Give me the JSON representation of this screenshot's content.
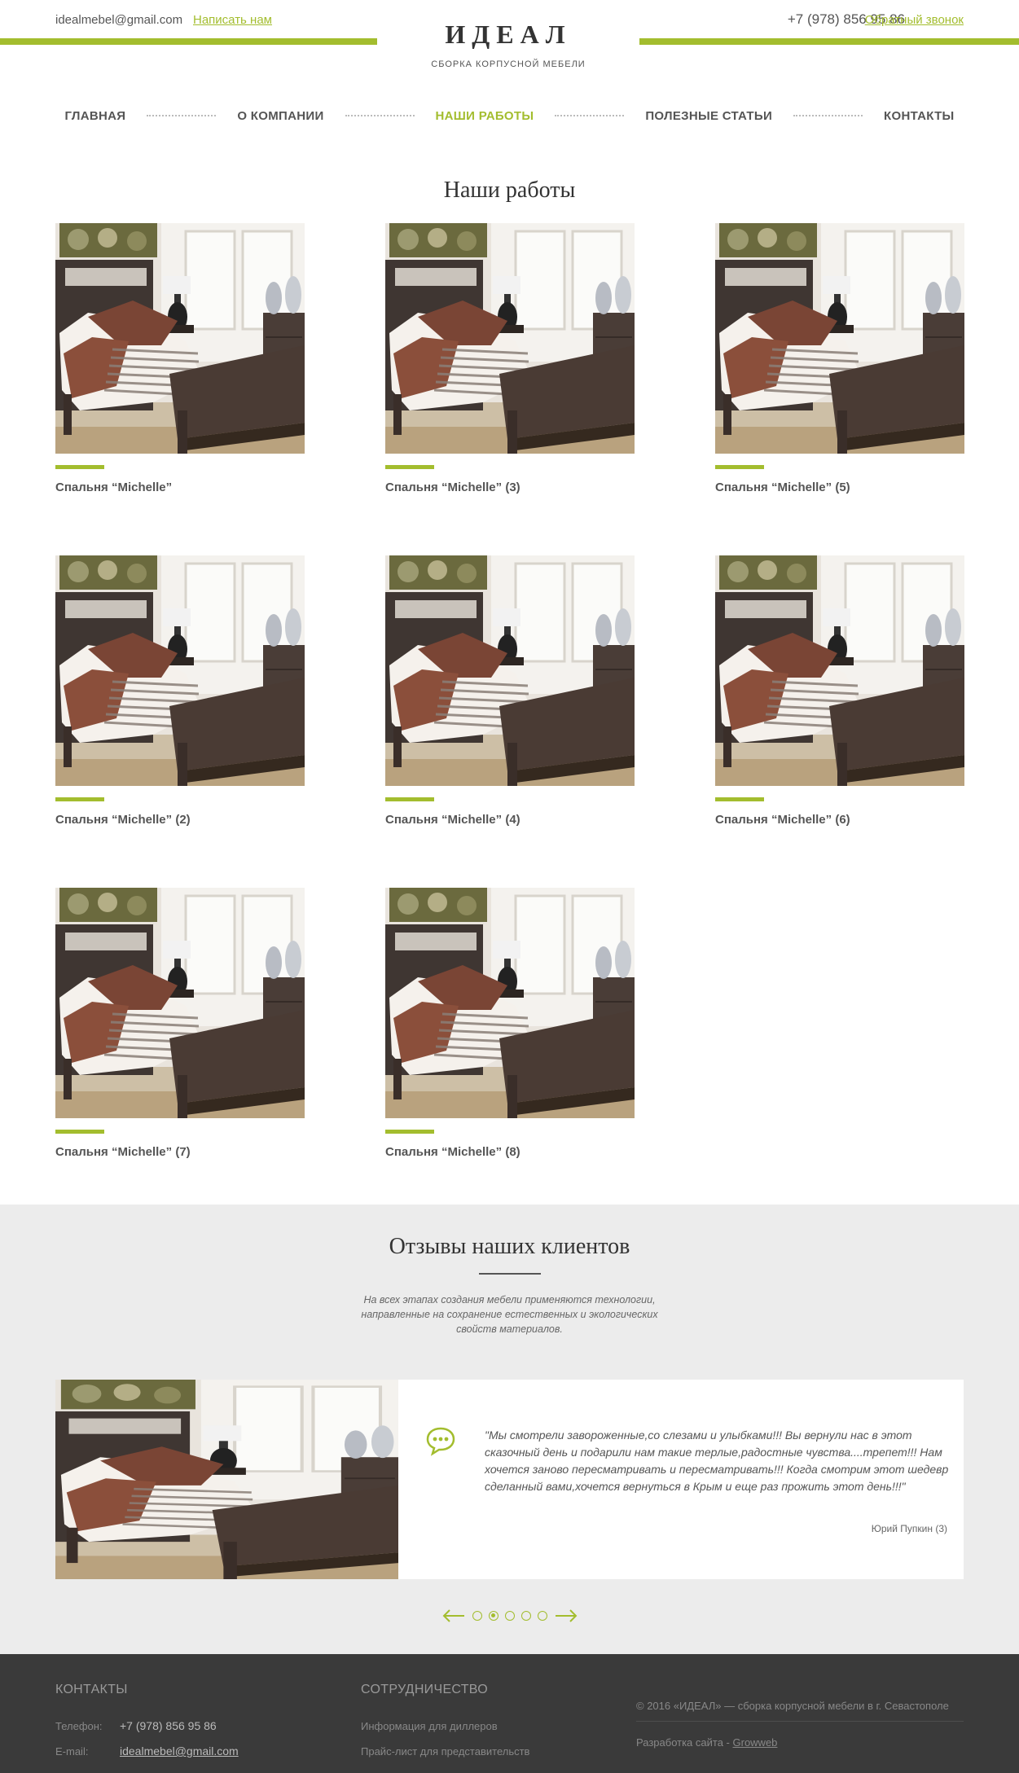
{
  "header": {
    "email": "idealmebel@gmail.com",
    "write_link": "Написать нам",
    "phone": "+7 (978) 856 95 86",
    "callback_link": "Обратный звонок",
    "logo_title": "ИДЕАЛ",
    "logo_subtitle": "СБОРКА КОРПУСНОЙ МЕБЕЛИ"
  },
  "nav": {
    "items": [
      {
        "label": "ГЛАВНАЯ"
      },
      {
        "label": "О КОМПАНИИ"
      },
      {
        "label": "НАШИ РАБОТЫ"
      },
      {
        "label": "ПОЛЕЗНЫЕ СТАТЬИ"
      },
      {
        "label": "КОНТАКТЫ"
      }
    ],
    "active_index": 2
  },
  "works": {
    "title": "Наши работы",
    "items": [
      {
        "label": "Спальня “Michelle”"
      },
      {
        "label": "Спальня “Michelle” (3)"
      },
      {
        "label": "Спальня “Michelle” (5)"
      },
      {
        "label": "Спальня “Michelle” (2)"
      },
      {
        "label": "Спальня “Michelle” (4)"
      },
      {
        "label": "Спальня “Michelle” (6)"
      },
      {
        "label": "Спальня “Michelle” (7)"
      },
      {
        "label": "Спальня “Michelle” (8)"
      }
    ]
  },
  "reviews": {
    "title": "Отзывы наших клиентов",
    "description": "На всех этапах создания мебели применяются технологии, направленные на сохранение естественных и экологических свойств материалов.",
    "review_text": "\"Мы смотрели завороженные,со слезами и улыбками!!! Вы вернули нас в этот сказочный день и подарили нам такие терлые,радостные чувства....трепет!!! Нам хочется заново пересматривать и пересматривать!!! Когда смотрим этот шедевр сделанный вами,хочется вернуться в Крым и еще раз прожить этот день!!!\"",
    "review_author": "Юрий Пупкин (3)",
    "dots_count": 5,
    "active_dot": 1
  },
  "footer": {
    "contacts_title": "КОНТАКТЫ",
    "phone_label": "Телефон:",
    "phone_value": "+7 (978) 856 95 86",
    "email_label": "E-mail:",
    "email_value": "idealmebel@gmail.com",
    "coop_title": "СОТРУДНИЧЕСТВО",
    "coop_link1": "Информация для диллеров",
    "coop_link2": "Прайс-лист для представительств",
    "copyright": "© 2016 «ИДЕАЛ» — сборка корпусной мебели в г. Севастополе",
    "dev_prefix": "Разработка сайта - ",
    "dev_link": "Growweb"
  },
  "colors": {
    "accent": "#a3bd2e",
    "footer_bg": "#3a3a3a",
    "reviews_bg": "#ececec"
  }
}
